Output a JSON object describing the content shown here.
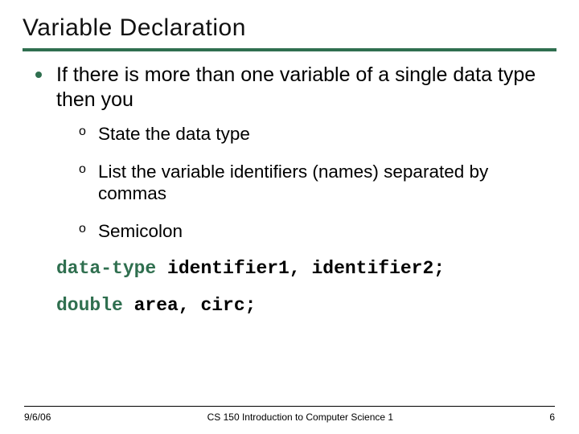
{
  "title": "Variable Declaration",
  "bullets": {
    "main": "If there is more than one variable of a single data type then you",
    "subs": [
      "State the data type",
      "List the variable identifiers (names) separated by commas",
      "Semicolon"
    ]
  },
  "code": {
    "line1_kw": "data-type",
    "line1_rest": " identifier1, identifier2;",
    "line2_kw": "double",
    "line2_rest": " area, circ;"
  },
  "footer": {
    "left": "9/6/06",
    "center": "CS 150 Introduction to Computer Science 1",
    "right": "6"
  }
}
